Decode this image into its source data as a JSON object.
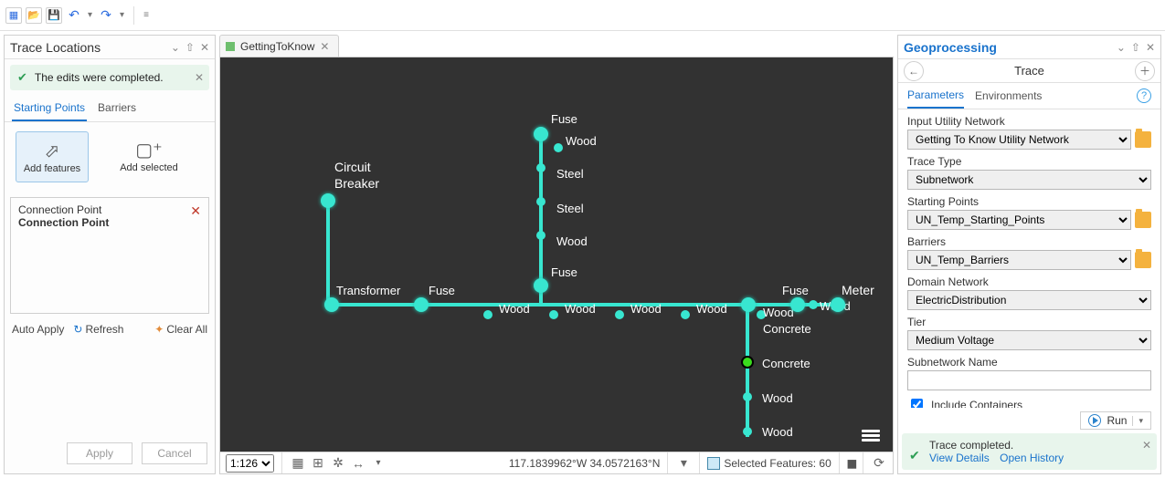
{
  "ribbon": {
    "menu": "≡"
  },
  "left": {
    "title": "Trace Locations",
    "banner": "The edits were completed.",
    "tabs": {
      "starting": "Starting Points",
      "barriers": "Barriers"
    },
    "addFeatures": "Add features",
    "addSelected": "Add selected",
    "listTop": "Connection Point",
    "listBottom": "Connection Point",
    "autoApply": "Auto Apply",
    "refresh": "Refresh",
    "clearAll": "Clear All",
    "apply": "Apply",
    "cancel": "Cancel"
  },
  "center": {
    "tab": "GettingToKnow",
    "scale": "1:126",
    "coords": "117.1839962°W 34.0572163°N",
    "selected": "Selected Features: 60"
  },
  "labels": {
    "circuitBreaker1": "Circuit",
    "circuitBreaker2": "Breaker",
    "transformer": "Transformer",
    "fuse": "Fuse",
    "meter": "Meter",
    "wood": "Wood",
    "steel": "Steel",
    "concrete": "Concrete"
  },
  "right": {
    "paneTitle": "Geoprocessing",
    "toolTitle": "Trace",
    "tabs": {
      "params": "Parameters",
      "env": "Environments"
    },
    "p_inputUN": "Input Utility Network",
    "v_inputUN": "Getting To Know Utility Network",
    "p_traceType": "Trace Type",
    "v_traceType": "Subnetwork",
    "p_sp": "Starting Points",
    "v_sp": "UN_Temp_Starting_Points",
    "p_barriers": "Barriers",
    "v_barriers": "UN_Temp_Barriers",
    "p_domain": "Domain Network",
    "v_domain": "ElectricDistribution",
    "p_tier": "Tier",
    "v_tier": "Medium Voltage",
    "p_subnet": "Subnetwork Name",
    "v_subnet": "",
    "includeContainers": "Include Containers",
    "run": "Run",
    "resultTitle": "Trace completed.",
    "viewDetails": "View Details",
    "openHistory": "Open History"
  }
}
